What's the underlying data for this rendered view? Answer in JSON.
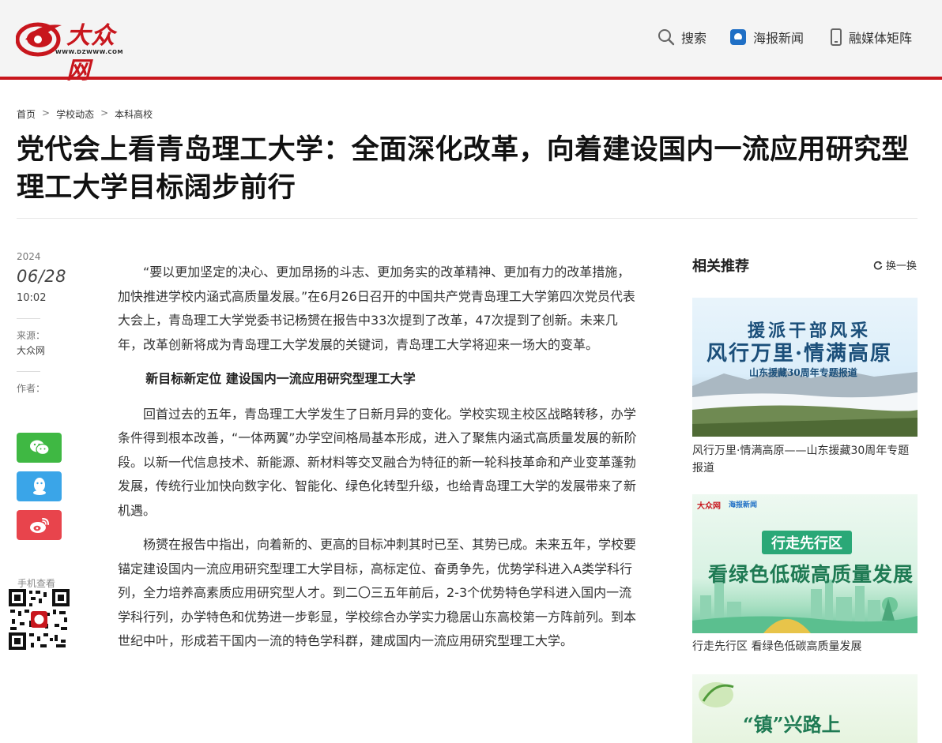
{
  "header": {
    "logo_text": "大众网",
    "logo_url": "WWW.DZWWW.COM",
    "nav": {
      "search": "搜索",
      "poster": "海报新闻",
      "media": "融媒体矩阵"
    },
    "colors": {
      "brand": "#c8161d"
    }
  },
  "breadcrumb": {
    "items": [
      "首页",
      "学校动态",
      "本科高校"
    ],
    "separator": ">"
  },
  "article": {
    "title": "党代会上看青岛理工大学：全面深化改革，向着建设国内一流应用研究型理工大学目标阔步前行",
    "year": "2024",
    "month_day": "06/28",
    "time": "10:02",
    "source_label": "来源：",
    "source": "大众网",
    "author_label": "作者：",
    "paragraphs": [
      "“要以更加坚定的决心、更加昂扬的斗志、更加务实的改革精神、更加有力的改革措施，加快推进学校内涵式高质量发展。”在6月26日召开的中国共产党青岛理工大学第四次党员代表大会上，青岛理工大学党委书记杨赟在报告中33次提到了改革，47次提到了创新。未来几年，改革创新将成为青岛理工大学发展的关键词，青岛理工大学将迎来一场大的变革。",
      "新目标新定位 建设国内一流应用研究型理工大学",
      "回首过去的五年，青岛理工大学发生了日新月异的变化。学校实现主校区战略转移，办学条件得到根本改善，“一体两翼”办学空间格局基本形成，进入了聚焦内涵式高质量发展的新阶段。以新一代信息技术、新能源、新材料等交叉融合为特征的新一轮科技革命和产业变革蓬勃发展，传统行业加快向数字化、智能化、绿色化转型升级，也给青岛理工大学的发展带来了新机遇。",
      "杨赟在报告中指出，向着新的、更高的目标冲刺其时已至、其势已成。未来五年，学校要锚定建设国内一流应用研究型理工大学目标，高标定位、奋勇争先，优势学科进入A类学科行列，全力培养高素质应用研究型人才。到二〇三五年前后，2-3个优势特色学科进入国内一流学科行列，办学特色和优势进一步彰显，学校综合办学实力稳居山东高校第一方阵前列。到本世纪中叶，形成若干国内一流的特色学科群，建成国内一流应用研究型理工大学。"
    ]
  },
  "share": {
    "wechat_icon": "wechat-icon",
    "qq_icon": "qq-icon",
    "weibo_icon": "weibo-icon",
    "qr_label": "手机查看"
  },
  "sidebar": {
    "title": "相关推荐",
    "refresh": "换一换",
    "cards": [
      {
        "caption": "风行万里·情满高原——山东援藏30周年专题报道",
        "poster_line1": "援派干部风采",
        "poster_line2": "风行万里·情满高原",
        "poster_line3": "山东援藏30周年专题报道"
      },
      {
        "caption": "行走先行区 看绿色低碳高质量发展",
        "poster_badge": "行走先行区",
        "poster_main": "看绿色低碳高质量发展",
        "poster_logo": "大众网",
        "poster_logo2": "海报新闻"
      },
      {
        "poster_main": "“镇”兴路上"
      }
    ]
  }
}
